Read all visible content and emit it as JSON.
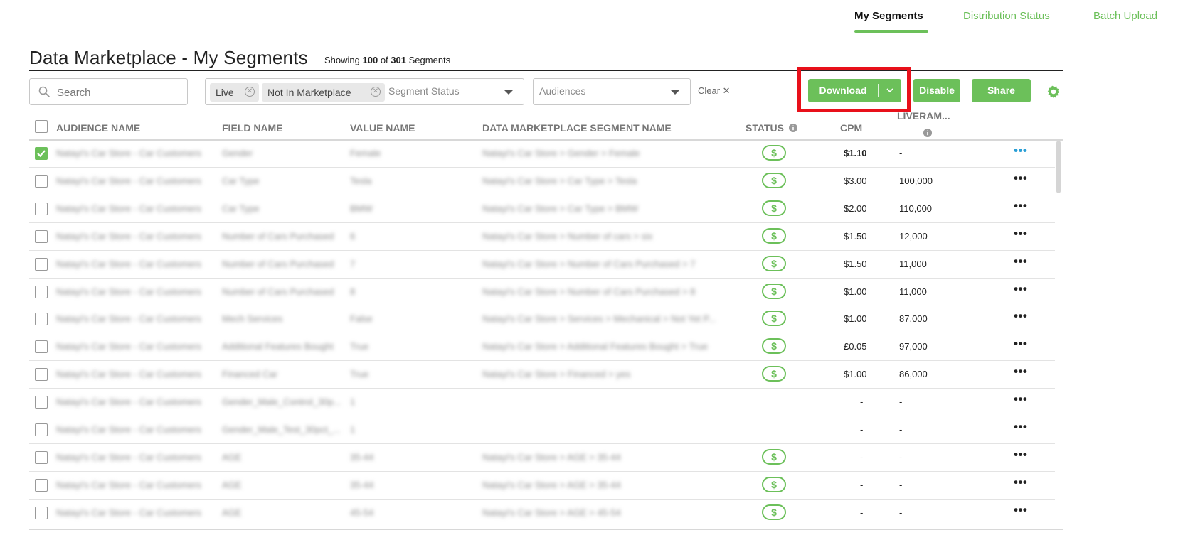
{
  "nav": {
    "my_segments": "My Segments",
    "distribution_status": "Distribution Status",
    "batch_upload": "Batch Upload"
  },
  "header": {
    "title": "Data Marketplace - My Segments",
    "showing_prefix": "Showing",
    "shown_count": "100",
    "of_label": "of",
    "total_count": "301",
    "segments_label": "Segments"
  },
  "filters": {
    "search_placeholder": "Search",
    "chips": [
      "Live",
      "Not In Marketplace"
    ],
    "segment_status_placeholder": "Segment Status",
    "audiences_placeholder": "Audiences",
    "clear_label": "Clear ✕"
  },
  "actions": {
    "download": "Download",
    "disable": "Disable",
    "share": "Share"
  },
  "columns": {
    "audience_name": "AUDIENCE NAME",
    "field_name": "FIELD NAME",
    "value_name": "VALUE NAME",
    "segment_name": "DATA MARKETPLACE SEGMENT NAME",
    "status": "STATUS",
    "cpm": "CPM",
    "liveramp": "LIVERAM..."
  },
  "colors": {
    "accent": "#6cc05a",
    "highlight": "#e8101a",
    "link_active": "#2a9fd6"
  },
  "rows": [
    {
      "checked": true,
      "audience": "Natayi's Car Store - Car Customers",
      "field": "Gender",
      "value": "Female",
      "segment": "Natayi's Car Store > Gender > Female",
      "has_status": true,
      "cpm": "$1.10",
      "liveramp": "-",
      "cpm_bold": true
    },
    {
      "checked": false,
      "audience": "Natayi's Car Store - Car Customers",
      "field": "Car Type",
      "value": "Tesla",
      "segment": "Natayi's Car Store > Car Type > Tesla",
      "has_status": true,
      "cpm": "$3.00",
      "liveramp": "100,000"
    },
    {
      "checked": false,
      "audience": "Natayi's Car Store - Car Customers",
      "field": "Car Type",
      "value": "BMW",
      "segment": "Natayi's Car Store > Car Type > BMW",
      "has_status": true,
      "cpm": "$2.00",
      "liveramp": "110,000"
    },
    {
      "checked": false,
      "audience": "Natayi's Car Store - Car Customers",
      "field": "Number of Cars Purchased",
      "value": "6",
      "segment": "Natayi's Car Store > Number of cars > six",
      "has_status": true,
      "cpm": "$1.50",
      "liveramp": "12,000"
    },
    {
      "checked": false,
      "audience": "Natayi's Car Store - Car Customers",
      "field": "Number of Cars Purchased",
      "value": "7",
      "segment": "Natayi's Car Store > Number of Cars Purchased > 7",
      "has_status": true,
      "cpm": "$1.50",
      "liveramp": "11,000"
    },
    {
      "checked": false,
      "audience": "Natayi's Car Store - Car Customers",
      "field": "Number of Cars Purchased",
      "value": "8",
      "segment": "Natayi's Car Store > Number of Cars Purchased > 8",
      "has_status": true,
      "cpm": "$1.00",
      "liveramp": "11,000"
    },
    {
      "checked": false,
      "audience": "Natayi's Car Store - Car Customers",
      "field": "Mech Services",
      "value": "False",
      "segment": "Natayi's Car Store > Services > Mechanical > Not Yet P...",
      "has_status": true,
      "cpm": "$1.00",
      "liveramp": "87,000"
    },
    {
      "checked": false,
      "audience": "Natayi's Car Store - Car Customers",
      "field": "Additional Features Bought",
      "value": "True",
      "segment": "Natayi's Car Store > Additional Features Bought > True",
      "has_status": true,
      "cpm": "£0.05",
      "liveramp": "97,000"
    },
    {
      "checked": false,
      "audience": "Natayi's Car Store - Car Customers",
      "field": "Financed Car",
      "value": "True",
      "segment": "Natayi's Car Store > Financed > yes",
      "has_status": true,
      "cpm": "$1.00",
      "liveramp": "86,000"
    },
    {
      "checked": false,
      "audience": "Natayi's Car Store - Car Customers",
      "field": "Gender_Male_Control_30p...",
      "value": "1",
      "segment": "",
      "has_status": false,
      "cpm": "-",
      "liveramp": "-"
    },
    {
      "checked": false,
      "audience": "Natayi's Car Store - Car Customers",
      "field": "Gender_Male_Test_30pct_...",
      "value": "1",
      "segment": "",
      "has_status": false,
      "cpm": "-",
      "liveramp": "-"
    },
    {
      "checked": false,
      "audience": "Natayi's Car Store - Car Customers",
      "field": "AGE",
      "value": "35-44",
      "segment": "Natayi's Car Store > AGE > 35-44",
      "has_status": true,
      "cpm": "-",
      "liveramp": "-"
    },
    {
      "checked": false,
      "audience": "Natayi's Car Store - Car Customers",
      "field": "AGE",
      "value": "35-44",
      "segment": "Natayi's Car Store > AGE > 35-44",
      "has_status": true,
      "cpm": "-",
      "liveramp": "-"
    },
    {
      "checked": false,
      "audience": "Natayi's Car Store - Car Customers",
      "field": "AGE",
      "value": "45-54",
      "segment": "Natayi's Car Store > AGE > 45-54",
      "has_status": true,
      "cpm": "-",
      "liveramp": "-"
    }
  ]
}
